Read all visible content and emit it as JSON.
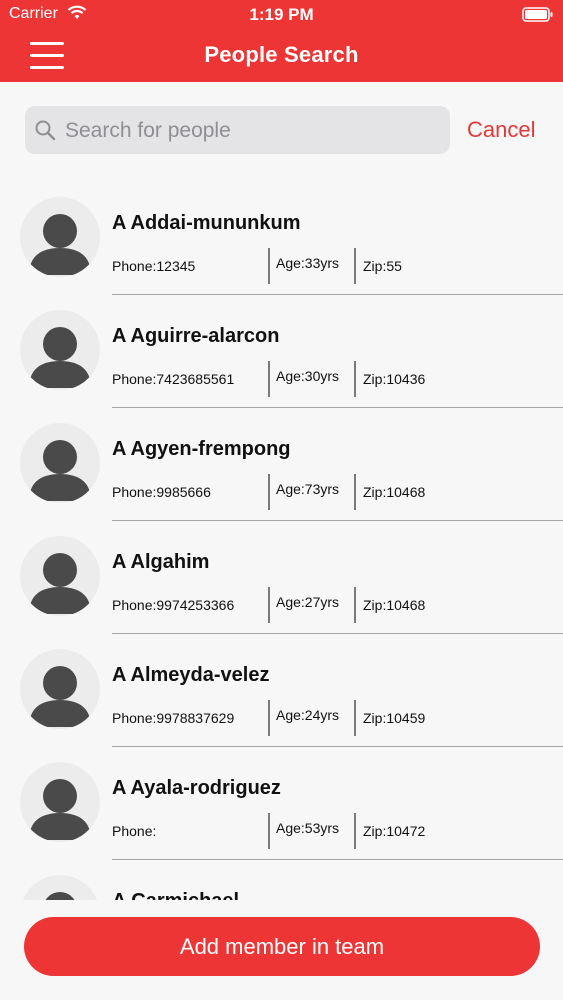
{
  "status_bar": {
    "carrier": "Carrier",
    "time": "1:19 PM"
  },
  "header": {
    "title": "People Search",
    "menu_icon": "menu-icon"
  },
  "search": {
    "value": "",
    "placeholder": "Search for people",
    "cancel_label": "Cancel"
  },
  "people": [
    {
      "name": "A Addai-mununkum",
      "phone": "Phone:12345",
      "age": "Age:33yrs",
      "zip": "Zip:55"
    },
    {
      "name": "A Aguirre-alarcon",
      "phone": "Phone:7423685561",
      "age": "Age:30yrs",
      "zip": "Zip:10436"
    },
    {
      "name": "A Agyen-frempong",
      "phone": "Phone:9985666",
      "age": "Age:73yrs",
      "zip": "Zip:10468"
    },
    {
      "name": "A Algahim",
      "phone": "Phone:9974253366",
      "age": "Age:27yrs",
      "zip": "Zip:10468"
    },
    {
      "name": "A Almeyda-velez",
      "phone": "Phone:9978837629",
      "age": "Age:24yrs",
      "zip": "Zip:10459"
    },
    {
      "name": "A Ayala-rodriguez",
      "phone": "Phone:",
      "age": "Age:53yrs",
      "zip": "Zip:10472"
    },
    {
      "name": "A Carmichael"
    }
  ],
  "footer": {
    "add_button_label": "Add member in team"
  },
  "colors": {
    "accent": "#ee3535",
    "cancel": "#e23a3a",
    "search_bg": "#e4e4e6"
  }
}
